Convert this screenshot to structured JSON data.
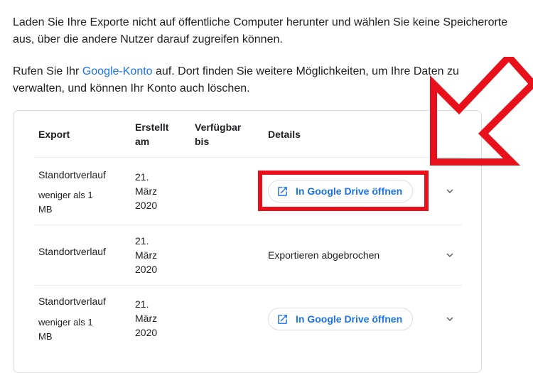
{
  "intro": {
    "paragraph1": "Laden Sie Ihre Exporte nicht auf öffentliche Computer herunter und wählen Sie keine Speicherorte aus, über die andere Nutzer darauf zugreifen können.",
    "paragraph2_before": "Rufen Sie Ihr ",
    "paragraph2_link": "Google-Konto",
    "paragraph2_after": " auf. Dort finden Sie weitere Möglichkeiten, um Ihre Daten zu verwalten, und können Ihr Konto auch löschen."
  },
  "table": {
    "headers": {
      "export": "Export",
      "erstellt": "Erstellt am",
      "verfuegbar": "Verfügbar bis",
      "details": "Details"
    },
    "rows": [
      {
        "name": "Standortverlauf",
        "size": "weniger als 1 MB",
        "date": "21. März 2020",
        "button": "In Google Drive öffnen"
      },
      {
        "name": "Standortverlauf",
        "date": "21. März 2020",
        "status": "Exportieren abgebrochen"
      },
      {
        "name": "Standortverlauf",
        "size": "weniger als 1 MB",
        "date": "21. März 2020",
        "button": "In Google Drive öffnen"
      }
    ]
  },
  "icons": {
    "open_external": "open-in-new-icon",
    "expand": "chevron-down-icon"
  },
  "colors": {
    "link": "#1a73e8",
    "annotation": "#e8101b",
    "border": "#dadce0"
  }
}
